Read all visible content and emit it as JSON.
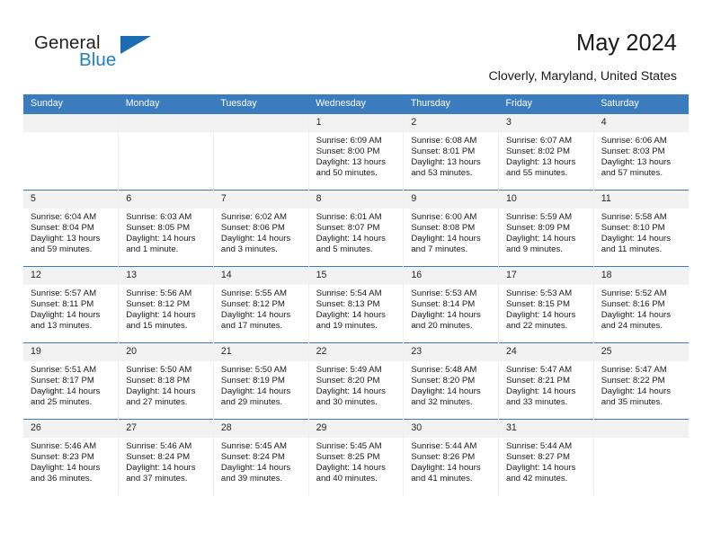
{
  "brand": {
    "name_part1": "General",
    "name_part2": "Blue",
    "accent_color": "#1f7fc4",
    "triangle_color": "#1b6cb3"
  },
  "header": {
    "title": "May 2024",
    "location": "Cloverly, Maryland, United States"
  },
  "theme": {
    "header_row_bg": "#3a7cbe",
    "daynum_bg": "#f2f2f2",
    "row_divider": "#3a7cbe",
    "text_color": "#1a1a1a"
  },
  "calendar": {
    "weekday_headers": [
      "Sunday",
      "Monday",
      "Tuesday",
      "Wednesday",
      "Thursday",
      "Friday",
      "Saturday"
    ],
    "labels": {
      "sunrise": "Sunrise:",
      "sunset": "Sunset:",
      "daylight": "Daylight:"
    },
    "weeks": [
      [
        {
          "day": "",
          "empty": true,
          "sunrise": "",
          "sunset": "",
          "daylight_1": "",
          "daylight_2": ""
        },
        {
          "day": "",
          "empty": true,
          "sunrise": "",
          "sunset": "",
          "daylight_1": "",
          "daylight_2": ""
        },
        {
          "day": "",
          "empty": true,
          "sunrise": "",
          "sunset": "",
          "daylight_1": "",
          "daylight_2": ""
        },
        {
          "day": "1",
          "empty": false,
          "sunrise": "Sunrise: 6:09 AM",
          "sunset": "Sunset: 8:00 PM",
          "daylight_1": "Daylight: 13 hours",
          "daylight_2": "and 50 minutes."
        },
        {
          "day": "2",
          "empty": false,
          "sunrise": "Sunrise: 6:08 AM",
          "sunset": "Sunset: 8:01 PM",
          "daylight_1": "Daylight: 13 hours",
          "daylight_2": "and 53 minutes."
        },
        {
          "day": "3",
          "empty": false,
          "sunrise": "Sunrise: 6:07 AM",
          "sunset": "Sunset: 8:02 PM",
          "daylight_1": "Daylight: 13 hours",
          "daylight_2": "and 55 minutes."
        },
        {
          "day": "4",
          "empty": false,
          "sunrise": "Sunrise: 6:06 AM",
          "sunset": "Sunset: 8:03 PM",
          "daylight_1": "Daylight: 13 hours",
          "daylight_2": "and 57 minutes."
        }
      ],
      [
        {
          "day": "5",
          "empty": false,
          "sunrise": "Sunrise: 6:04 AM",
          "sunset": "Sunset: 8:04 PM",
          "daylight_1": "Daylight: 13 hours",
          "daylight_2": "and 59 minutes."
        },
        {
          "day": "6",
          "empty": false,
          "sunrise": "Sunrise: 6:03 AM",
          "sunset": "Sunset: 8:05 PM",
          "daylight_1": "Daylight: 14 hours",
          "daylight_2": "and 1 minute."
        },
        {
          "day": "7",
          "empty": false,
          "sunrise": "Sunrise: 6:02 AM",
          "sunset": "Sunset: 8:06 PM",
          "daylight_1": "Daylight: 14 hours",
          "daylight_2": "and 3 minutes."
        },
        {
          "day": "8",
          "empty": false,
          "sunrise": "Sunrise: 6:01 AM",
          "sunset": "Sunset: 8:07 PM",
          "daylight_1": "Daylight: 14 hours",
          "daylight_2": "and 5 minutes."
        },
        {
          "day": "9",
          "empty": false,
          "sunrise": "Sunrise: 6:00 AM",
          "sunset": "Sunset: 8:08 PM",
          "daylight_1": "Daylight: 14 hours",
          "daylight_2": "and 7 minutes."
        },
        {
          "day": "10",
          "empty": false,
          "sunrise": "Sunrise: 5:59 AM",
          "sunset": "Sunset: 8:09 PM",
          "daylight_1": "Daylight: 14 hours",
          "daylight_2": "and 9 minutes."
        },
        {
          "day": "11",
          "empty": false,
          "sunrise": "Sunrise: 5:58 AM",
          "sunset": "Sunset: 8:10 PM",
          "daylight_1": "Daylight: 14 hours",
          "daylight_2": "and 11 minutes."
        }
      ],
      [
        {
          "day": "12",
          "empty": false,
          "sunrise": "Sunrise: 5:57 AM",
          "sunset": "Sunset: 8:11 PM",
          "daylight_1": "Daylight: 14 hours",
          "daylight_2": "and 13 minutes."
        },
        {
          "day": "13",
          "empty": false,
          "sunrise": "Sunrise: 5:56 AM",
          "sunset": "Sunset: 8:12 PM",
          "daylight_1": "Daylight: 14 hours",
          "daylight_2": "and 15 minutes."
        },
        {
          "day": "14",
          "empty": false,
          "sunrise": "Sunrise: 5:55 AM",
          "sunset": "Sunset: 8:12 PM",
          "daylight_1": "Daylight: 14 hours",
          "daylight_2": "and 17 minutes."
        },
        {
          "day": "15",
          "empty": false,
          "sunrise": "Sunrise: 5:54 AM",
          "sunset": "Sunset: 8:13 PM",
          "daylight_1": "Daylight: 14 hours",
          "daylight_2": "and 19 minutes."
        },
        {
          "day": "16",
          "empty": false,
          "sunrise": "Sunrise: 5:53 AM",
          "sunset": "Sunset: 8:14 PM",
          "daylight_1": "Daylight: 14 hours",
          "daylight_2": "and 20 minutes."
        },
        {
          "day": "17",
          "empty": false,
          "sunrise": "Sunrise: 5:53 AM",
          "sunset": "Sunset: 8:15 PM",
          "daylight_1": "Daylight: 14 hours",
          "daylight_2": "and 22 minutes."
        },
        {
          "day": "18",
          "empty": false,
          "sunrise": "Sunrise: 5:52 AM",
          "sunset": "Sunset: 8:16 PM",
          "daylight_1": "Daylight: 14 hours",
          "daylight_2": "and 24 minutes."
        }
      ],
      [
        {
          "day": "19",
          "empty": false,
          "sunrise": "Sunrise: 5:51 AM",
          "sunset": "Sunset: 8:17 PM",
          "daylight_1": "Daylight: 14 hours",
          "daylight_2": "and 25 minutes."
        },
        {
          "day": "20",
          "empty": false,
          "sunrise": "Sunrise: 5:50 AM",
          "sunset": "Sunset: 8:18 PM",
          "daylight_1": "Daylight: 14 hours",
          "daylight_2": "and 27 minutes."
        },
        {
          "day": "21",
          "empty": false,
          "sunrise": "Sunrise: 5:50 AM",
          "sunset": "Sunset: 8:19 PM",
          "daylight_1": "Daylight: 14 hours",
          "daylight_2": "and 29 minutes."
        },
        {
          "day": "22",
          "empty": false,
          "sunrise": "Sunrise: 5:49 AM",
          "sunset": "Sunset: 8:20 PM",
          "daylight_1": "Daylight: 14 hours",
          "daylight_2": "and 30 minutes."
        },
        {
          "day": "23",
          "empty": false,
          "sunrise": "Sunrise: 5:48 AM",
          "sunset": "Sunset: 8:20 PM",
          "daylight_1": "Daylight: 14 hours",
          "daylight_2": "and 32 minutes."
        },
        {
          "day": "24",
          "empty": false,
          "sunrise": "Sunrise: 5:47 AM",
          "sunset": "Sunset: 8:21 PM",
          "daylight_1": "Daylight: 14 hours",
          "daylight_2": "and 33 minutes."
        },
        {
          "day": "25",
          "empty": false,
          "sunrise": "Sunrise: 5:47 AM",
          "sunset": "Sunset: 8:22 PM",
          "daylight_1": "Daylight: 14 hours",
          "daylight_2": "and 35 minutes."
        }
      ],
      [
        {
          "day": "26",
          "empty": false,
          "sunrise": "Sunrise: 5:46 AM",
          "sunset": "Sunset: 8:23 PM",
          "daylight_1": "Daylight: 14 hours",
          "daylight_2": "and 36 minutes."
        },
        {
          "day": "27",
          "empty": false,
          "sunrise": "Sunrise: 5:46 AM",
          "sunset": "Sunset: 8:24 PM",
          "daylight_1": "Daylight: 14 hours",
          "daylight_2": "and 37 minutes."
        },
        {
          "day": "28",
          "empty": false,
          "sunrise": "Sunrise: 5:45 AM",
          "sunset": "Sunset: 8:24 PM",
          "daylight_1": "Daylight: 14 hours",
          "daylight_2": "and 39 minutes."
        },
        {
          "day": "29",
          "empty": false,
          "sunrise": "Sunrise: 5:45 AM",
          "sunset": "Sunset: 8:25 PM",
          "daylight_1": "Daylight: 14 hours",
          "daylight_2": "and 40 minutes."
        },
        {
          "day": "30",
          "empty": false,
          "sunrise": "Sunrise: 5:44 AM",
          "sunset": "Sunset: 8:26 PM",
          "daylight_1": "Daylight: 14 hours",
          "daylight_2": "and 41 minutes."
        },
        {
          "day": "31",
          "empty": false,
          "sunrise": "Sunrise: 5:44 AM",
          "sunset": "Sunset: 8:27 PM",
          "daylight_1": "Daylight: 14 hours",
          "daylight_2": "and 42 minutes."
        },
        {
          "day": "",
          "empty": true,
          "sunrise": "",
          "sunset": "",
          "daylight_1": "",
          "daylight_2": ""
        }
      ]
    ]
  }
}
